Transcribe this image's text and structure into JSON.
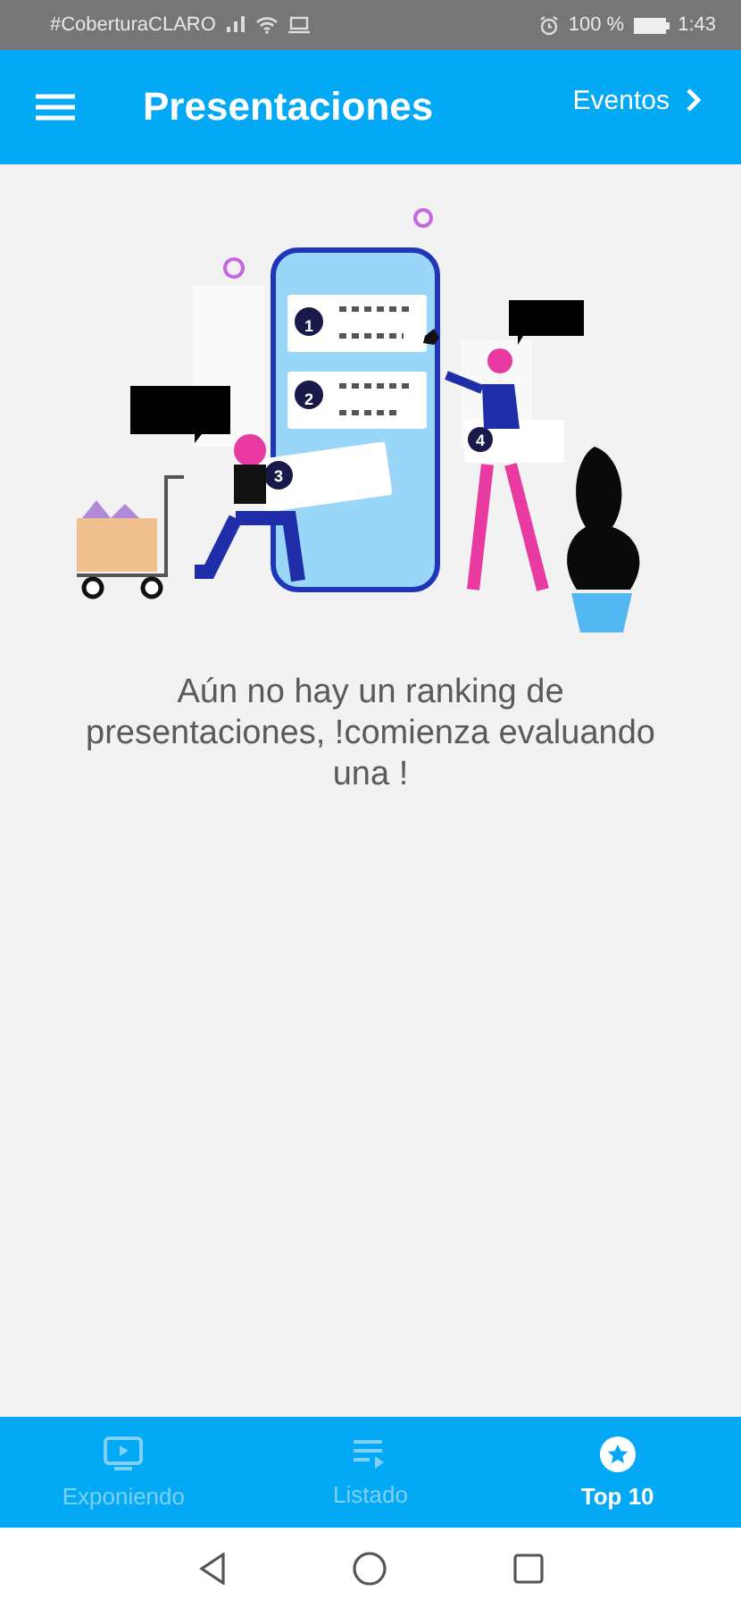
{
  "status_bar": {
    "carrier": "#CoberturaCLARO",
    "battery": "100 %",
    "time": "1:43"
  },
  "header": {
    "title": "Presentaciones",
    "action": "Eventos"
  },
  "illustration": {
    "ranks": [
      "1",
      "2",
      "3",
      "4"
    ]
  },
  "empty_message": "Aún no hay un ranking de presentaciones, !comienza evaluando una !",
  "bottom_nav": [
    {
      "label": "Exponiendo",
      "kind": "tv",
      "selected": false
    },
    {
      "label": "Listado",
      "kind": "list",
      "selected": false
    },
    {
      "label": "Top 10",
      "kind": "star",
      "selected": true
    }
  ]
}
